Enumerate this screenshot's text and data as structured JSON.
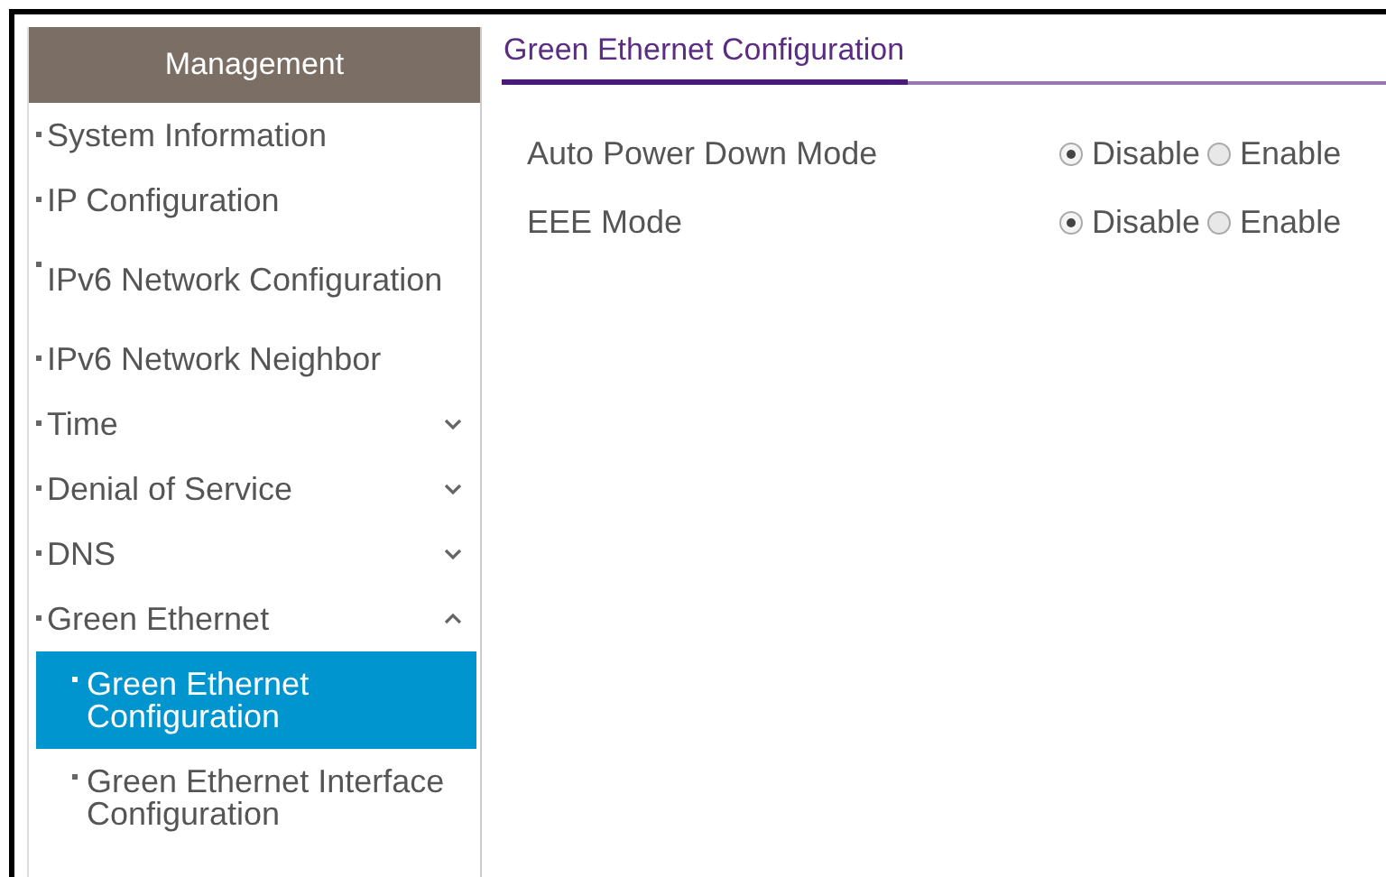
{
  "sidebar": {
    "title": "Management",
    "items": [
      {
        "label": "System Information",
        "kind": "link",
        "selected": false
      },
      {
        "label": "IP Configuration",
        "kind": "link",
        "selected": false
      },
      {
        "label": "IPv6 Network Configuration",
        "kind": "link",
        "selected": false
      },
      {
        "label": "IPv6 Network Neighbor",
        "kind": "link",
        "selected": false
      },
      {
        "label": "Time",
        "kind": "group",
        "selected": false,
        "expanded": false
      },
      {
        "label": "Denial of Service",
        "kind": "group",
        "selected": false,
        "expanded": false
      },
      {
        "label": "DNS",
        "kind": "group",
        "selected": false,
        "expanded": false
      },
      {
        "label": "Green Ethernet",
        "kind": "group",
        "selected": false,
        "expanded": true,
        "children": [
          {
            "label": "Green Ethernet Configuration",
            "selected": true
          },
          {
            "label": "Green Ethernet Interface Configuration",
            "selected": false
          }
        ]
      }
    ]
  },
  "content": {
    "tab": "Green Ethernet Configuration",
    "settings": [
      {
        "label": "Auto Power Down Mode",
        "options": [
          {
            "label": "Disable",
            "selected": true
          },
          {
            "label": "Enable",
            "selected": false
          }
        ]
      },
      {
        "label": "EEE Mode",
        "options": [
          {
            "label": "Disable",
            "selected": true
          },
          {
            "label": "Enable",
            "selected": false
          }
        ]
      }
    ]
  }
}
